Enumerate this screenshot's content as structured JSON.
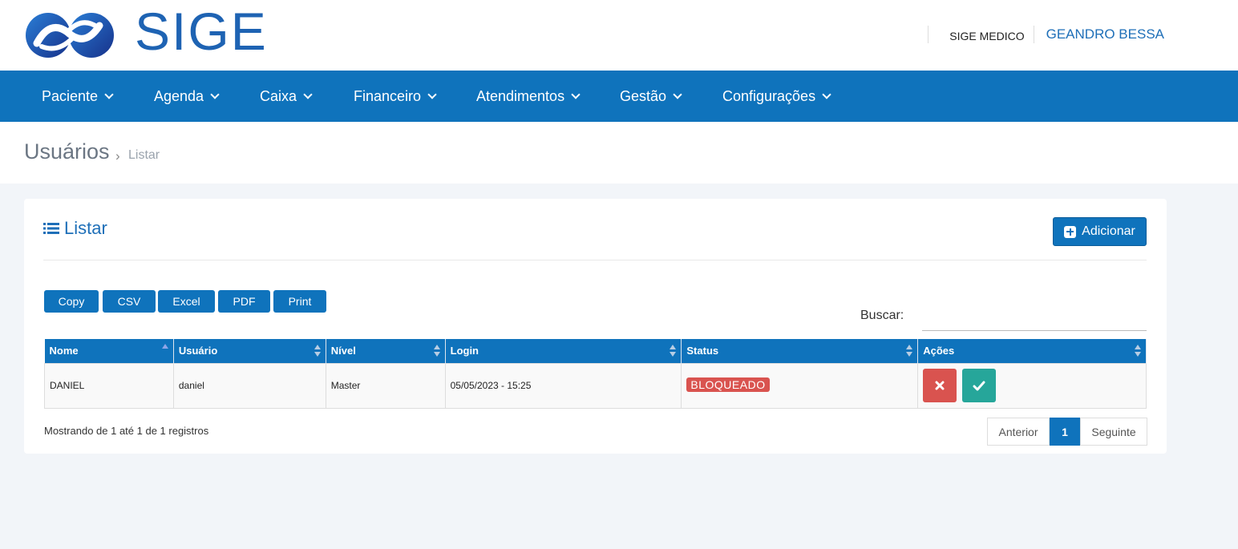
{
  "brand": {
    "logo_text": "SIGE",
    "color": "#1e63b3"
  },
  "header": {
    "system_name": "SIGE MEDICO",
    "user_name": "GEANDRO BESSA"
  },
  "nav": {
    "items": [
      {
        "label": "Paciente"
      },
      {
        "label": "Agenda"
      },
      {
        "label": "Caixa"
      },
      {
        "label": "Financeiro"
      },
      {
        "label": "Atendimentos"
      },
      {
        "label": "Gestão"
      },
      {
        "label": "Configurações"
      }
    ]
  },
  "breadcrumb": {
    "title": "Usuários",
    "separator": "›",
    "current": "Listar"
  },
  "card": {
    "title": "Listar",
    "add_button": "Adicionar",
    "export_buttons": [
      "Copy",
      "CSV",
      "Excel",
      "PDF",
      "Print"
    ],
    "search_label": "Buscar:",
    "search_value": ""
  },
  "table": {
    "columns": [
      "Nome",
      "Usuário",
      "Nível",
      "Login",
      "Status",
      "Ações"
    ],
    "sorted_column": "Nome",
    "sort_direction": "asc",
    "rows": [
      {
        "nome": "DANIEL",
        "usuario": "daniel",
        "nivel": "Master",
        "login": "05/05/2023 - 15:25",
        "status": "BLOQUEADO"
      }
    ]
  },
  "footer": {
    "info": "Mostrando de 1 até 1 de 1 registros",
    "prev": "Anterior",
    "page": "1",
    "next": "Seguinte"
  },
  "colors": {
    "primary": "#0f73bc",
    "danger": "#d9534f",
    "success": "#26a69a",
    "background": "#f2f5f9"
  }
}
